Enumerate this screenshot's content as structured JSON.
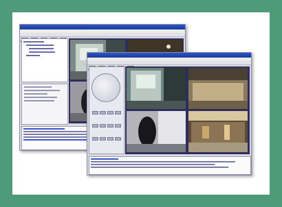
{
  "colors": {
    "frame": "#4f9a78",
    "titlebar": "#2c56c9",
    "camera_bg": "#2f2d5e"
  },
  "back_window": {
    "menu_items": [
      "",
      "",
      "",
      "",
      "",
      ""
    ],
    "cameras": [
      "camera-1",
      "camera-2",
      "camera-3",
      "camera-4"
    ]
  },
  "front_window": {
    "menu_items": [
      "",
      "",
      "",
      "",
      "",
      ""
    ],
    "cameras": [
      "camera-1",
      "camera-2",
      "camera-3",
      "camera-4"
    ]
  }
}
